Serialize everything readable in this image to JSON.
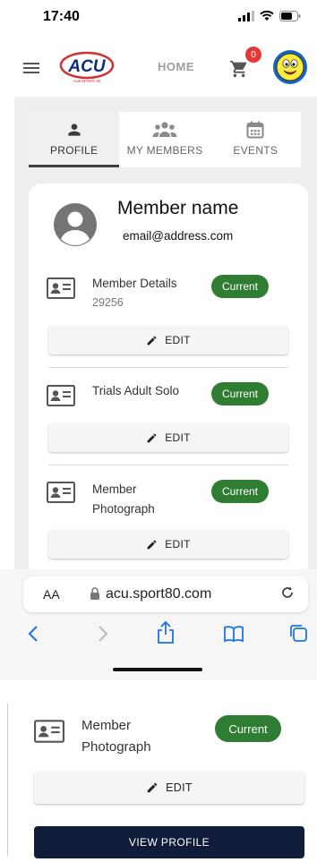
{
  "status_bar": {
    "time": "17:40"
  },
  "header": {
    "logo_text": "ACU",
    "logo_sub": "AUKSPORT 80",
    "home_label": "HOME",
    "cart_count": "0"
  },
  "tabs": [
    {
      "label": "PROFILE",
      "active": true
    },
    {
      "label": "MY MEMBERS",
      "active": false
    },
    {
      "label": "EVENTS",
      "active": false
    }
  ],
  "member": {
    "name": "Member name",
    "email": "email@address.com"
  },
  "items": [
    {
      "title": "Member Details",
      "subtitle": "29256",
      "status": "Current",
      "edit_label": "EDIT"
    },
    {
      "title": "Trials Adult Solo",
      "status": "Current",
      "edit_label": "EDIT"
    },
    {
      "title_line1": "Member",
      "title_line2": "Photograph",
      "status": "Current",
      "edit_label": "EDIT"
    }
  ],
  "browser": {
    "aa_label": "AA",
    "url": "acu.sport80.com"
  },
  "lower": {
    "title_line1": "Member",
    "title_line2": "Photograph",
    "status": "Current",
    "edit_label": "EDIT",
    "view_profile_label": "VIEW PROFILE"
  },
  "colors": {
    "accent_green": "#2e7d32",
    "navy_button": "#111c3a",
    "badge_red": "#e53935"
  }
}
